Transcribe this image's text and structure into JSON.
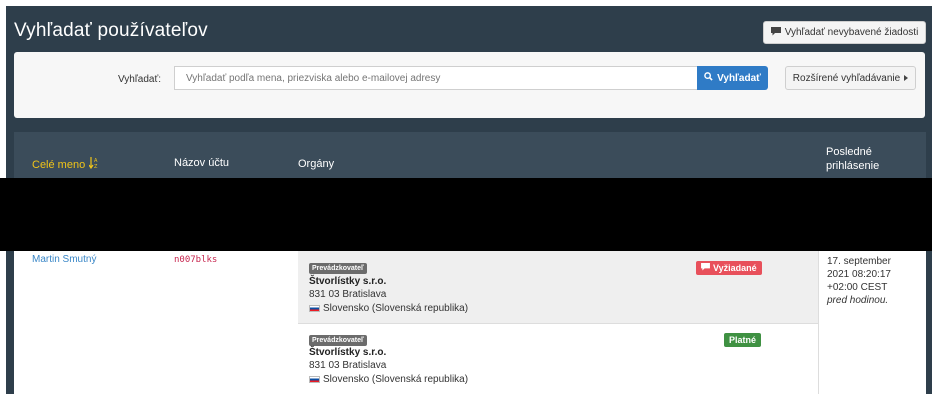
{
  "page": {
    "title": "Vyhľadať používateľov",
    "unprocessed_button": "Vyhľadať nevybavené žiadosti"
  },
  "search": {
    "label": "Vyhľadať:",
    "placeholder": "Vyhľadať podľa mena, priezviska alebo e-mailovej adresy",
    "button": "Vyhľadať",
    "advanced_button": "Rozšírené vyhľadávanie"
  },
  "table": {
    "headers": {
      "name": "Celé meno",
      "account": "Názov účtu",
      "organs": "Orgány",
      "last_login_line1": "Posledné",
      "last_login_line2": "prihlásenie"
    },
    "rows": [
      {
        "name": "Martin Smutný",
        "account": "n007blks",
        "organs": [
          {
            "role": "Prevádzkovateľ",
            "name": "Štvorlístky s.r.o.",
            "address": "831 03 Bratislava",
            "country": "Slovensko (Slovenská republika)",
            "status": "Vyžiadané"
          },
          {
            "role": "Prevádzkovateľ",
            "name": "Štvorlístky s.r.o.",
            "address": "831 03 Bratislava",
            "country": "Slovensko (Slovenská republika)",
            "status": "Platné"
          }
        ],
        "last_login": {
          "line1": "17. september",
          "line2": "2021 08:20:17",
          "line3": "+02:00 CEST",
          "relative": "pred hodinou."
        }
      }
    ]
  },
  "colors": {
    "panel": "#2e3e4b",
    "accent": "#2f7bc6",
    "sort_header": "#f0c419",
    "link": "#3a87c7",
    "requested": "#e8505b",
    "valid": "#3f9142"
  }
}
